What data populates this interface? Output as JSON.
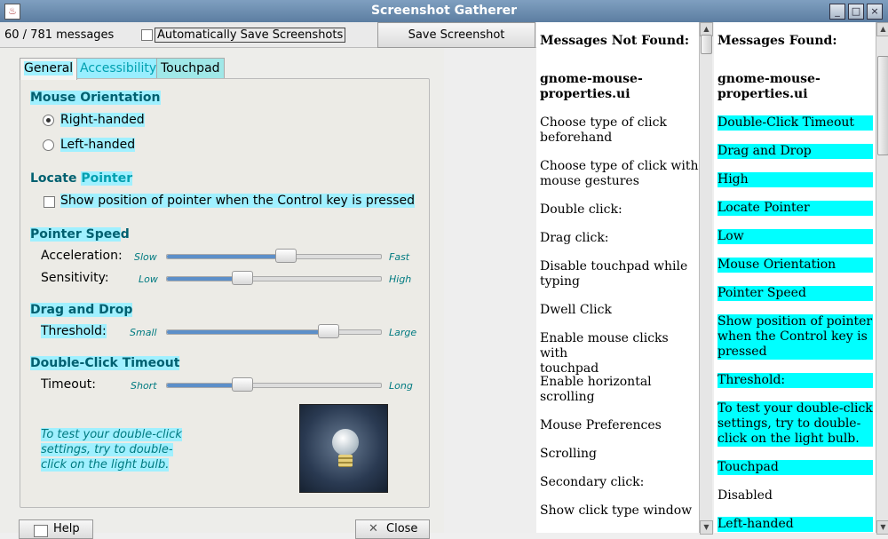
{
  "window": {
    "title": "Screenshot Gatherer",
    "minimize": "_",
    "maximize": "□",
    "close": "×"
  },
  "toolbar": {
    "count": "60 / 781 messages",
    "autosave_label": "Automatically Save Screenshots",
    "save_label": "Save Screenshot"
  },
  "dialog": {
    "tabs": [
      "General",
      "Accessibility",
      "Touchpad"
    ],
    "mouse_orientation": {
      "heading": "Mouse Orientation",
      "right": "Right-handed",
      "left": "Left-handed"
    },
    "locate_pointer": {
      "heading_a": "Locate ",
      "heading_b": "Pointer",
      "checkbox": "Show position of pointer when the Control key is pressed"
    },
    "pointer_speed": {
      "heading_a": "Pointer Spee",
      "heading_b": "d",
      "acceleration": {
        "label": "Acceleration:",
        "min": "Slow",
        "max": "Fast",
        "value": 0.55
      },
      "sensitivity": {
        "label": "Sensitivity:",
        "min": "Low",
        "max": "High",
        "value": 0.35
      }
    },
    "drag_drop": {
      "heading": "Drag and Drop",
      "threshold": {
        "label": "Threshold:",
        "min": "Small",
        "max": "Large",
        "value": 0.75
      }
    },
    "double_click": {
      "heading": "Double-Click Timeout",
      "timeout": {
        "label": "Timeout:",
        "min": "Short",
        "max": "Long",
        "value": 0.35
      },
      "hint_1": "To test your double-click",
      "hint_2": "settings, try to double-",
      "hint_3": "click on the light bulb."
    },
    "help_label": "Help",
    "close_label": "Close"
  },
  "not_found": {
    "header": "Messages Not Found:",
    "items": [
      [
        "gnome-mouse-",
        "properties.ui"
      ],
      [
        "Choose type of click",
        "beforehand"
      ],
      [
        "Choose type of click with",
        "mouse gestures"
      ],
      [
        "Double click:"
      ],
      [
        "Drag click:"
      ],
      [
        "Disable touchpad while",
        "typing"
      ],
      [
        "Dwell Click"
      ],
      [
        "Enable mouse clicks with",
        "touchpad"
      ],
      [
        "Enable horizontal",
        "scrolling"
      ],
      [
        "Mouse Preferences"
      ],
      [
        "Scrolling"
      ],
      [
        "Secondary click:"
      ],
      [
        "Show click type window"
      ]
    ]
  },
  "found": {
    "header": "Messages Found:",
    "items": [
      {
        "lines": [
          "gnome-mouse-",
          "properties.ui"
        ],
        "hl": false
      },
      {
        "lines": [
          "Double-Click Timeout"
        ],
        "hl": true
      },
      {
        "lines": [
          "Drag and Drop"
        ],
        "hl": true
      },
      {
        "lines": [
          "High"
        ],
        "hl": true
      },
      {
        "lines": [
          "Locate Pointer"
        ],
        "hl": true
      },
      {
        "lines": [
          "Low"
        ],
        "hl": true
      },
      {
        "lines": [
          "Mouse Orientation"
        ],
        "hl": true
      },
      {
        "lines": [
          "Pointer Speed"
        ],
        "hl": true
      },
      {
        "lines": [
          "Show position of pointer",
          "when the Control key is",
          "pressed"
        ],
        "hl": true
      },
      {
        "lines": [
          "Threshold:"
        ],
        "hl": true
      },
      {
        "lines": [
          "To test your double-click",
          "settings, try to double-",
          "click on the light bulb."
        ],
        "hl": true
      },
      {
        "lines": [
          "Touchpad"
        ],
        "hl": true
      },
      {
        "lines": [
          "Disabled"
        ],
        "hl": false
      },
      {
        "lines": [
          "Left-handed"
        ],
        "hl": true
      }
    ]
  }
}
